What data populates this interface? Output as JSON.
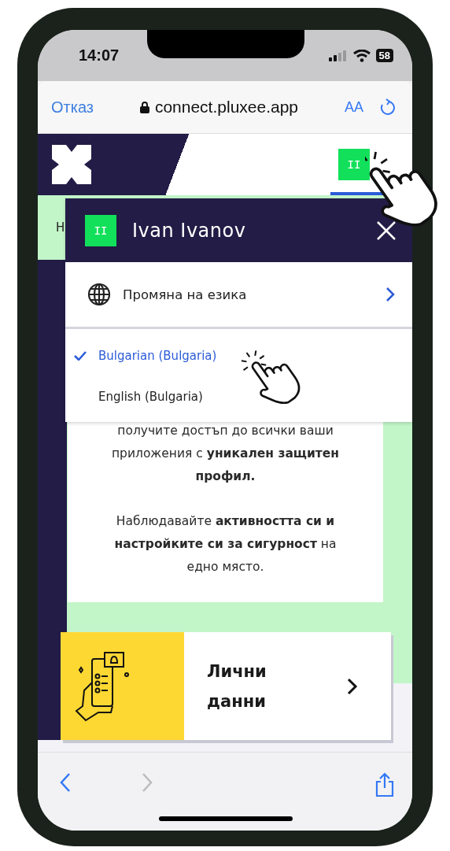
{
  "status_bar": {
    "time": "14:07",
    "battery": "58"
  },
  "browser": {
    "cancel": "Отказ",
    "url": "connect.pluxee.app",
    "text_size": "AA"
  },
  "header": {
    "avatar": "II"
  },
  "side_letter": "Н",
  "account_menu": {
    "avatar": "II",
    "name": "Ivan Ivanov",
    "item": "Промяна на езика",
    "languages": [
      {
        "label": "Bulgarian (Bulgaria)",
        "selected": true
      },
      {
        "label": "English (Bulgaria)",
        "selected": false
      }
    ]
  },
  "intro": {
    "paragraphs": [
      "получите достъп до всички ваши приложения с **уникален защитен профил.**",
      "Наблюдавайте **активността си и настройките си за сигурност** на едно място."
    ]
  },
  "feature_card": {
    "title": "Лични данни"
  },
  "toolbar": {
    "back": {
      "disabled": false
    },
    "forward": {
      "disabled": true
    }
  }
}
